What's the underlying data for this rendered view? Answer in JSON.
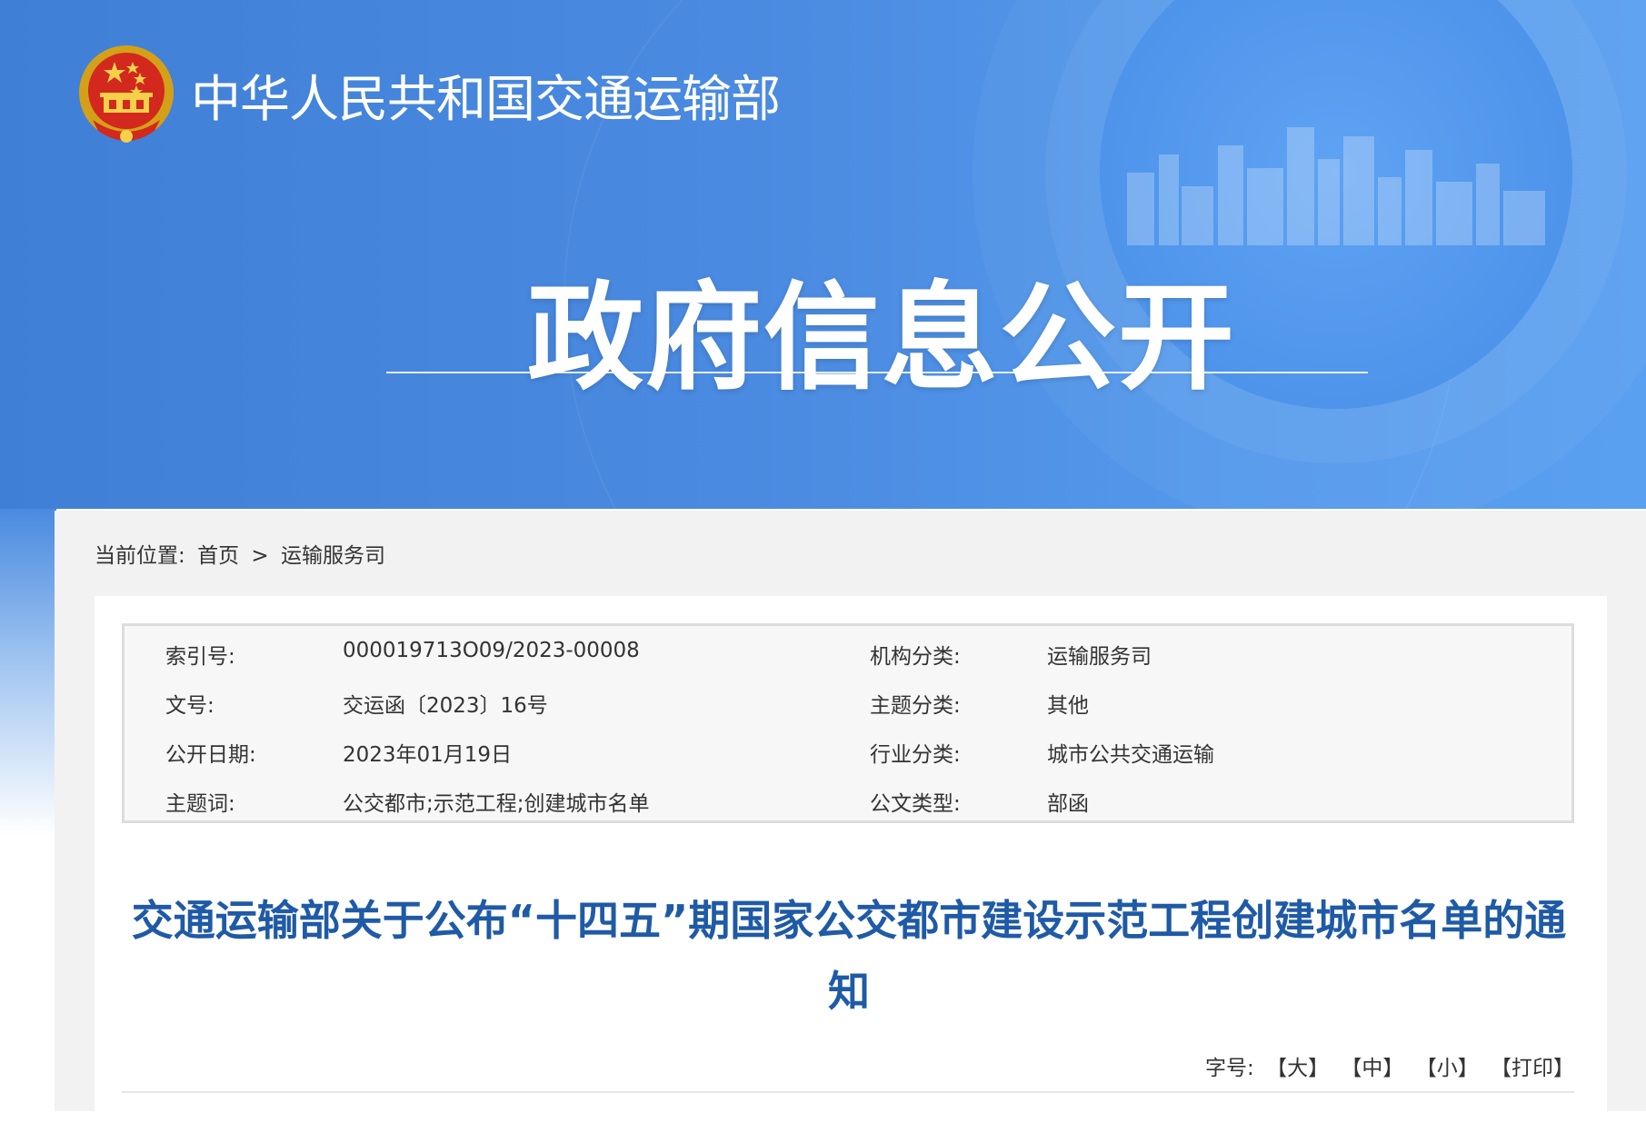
{
  "header": {
    "ministry_name": "中华人民共和国交通运输部",
    "banner_title": "政府信息公开"
  },
  "breadcrumb": {
    "label": "当前位置:",
    "home": "首页",
    "separator": ">",
    "current": "运输服务司"
  },
  "metadata": [
    {
      "label1": "索引号:",
      "value1": "000019713O09/2023-00008",
      "label2": "机构分类:",
      "value2": "运输服务司"
    },
    {
      "label1": "文号:",
      "value1": "交运函〔2023〕16号",
      "label2": "主题分类:",
      "value2": "其他"
    },
    {
      "label1": "公开日期:",
      "value1": "2023年01月19日",
      "label2": "行业分类:",
      "value2": "城市公共交通运输"
    },
    {
      "label1": "主题词:",
      "value1": "公交都市;示范工程;创建城市名单",
      "label2": "公文类型:",
      "value2": "部函"
    }
  ],
  "document": {
    "title": "交通运输部关于公布“十四五”期国家公交都市建设示范工程创建城市名单的通知"
  },
  "font_size": {
    "label": "字号:",
    "large": "【大】",
    "medium": "【中】",
    "small": "【小】",
    "print": "【打印】"
  },
  "colors": {
    "header_blue": "#4a8ae0",
    "title_blue": "#1f5aa6",
    "panel_gray": "#f2f2f2"
  },
  "icons": {
    "emblem": "national-emblem-icon"
  }
}
